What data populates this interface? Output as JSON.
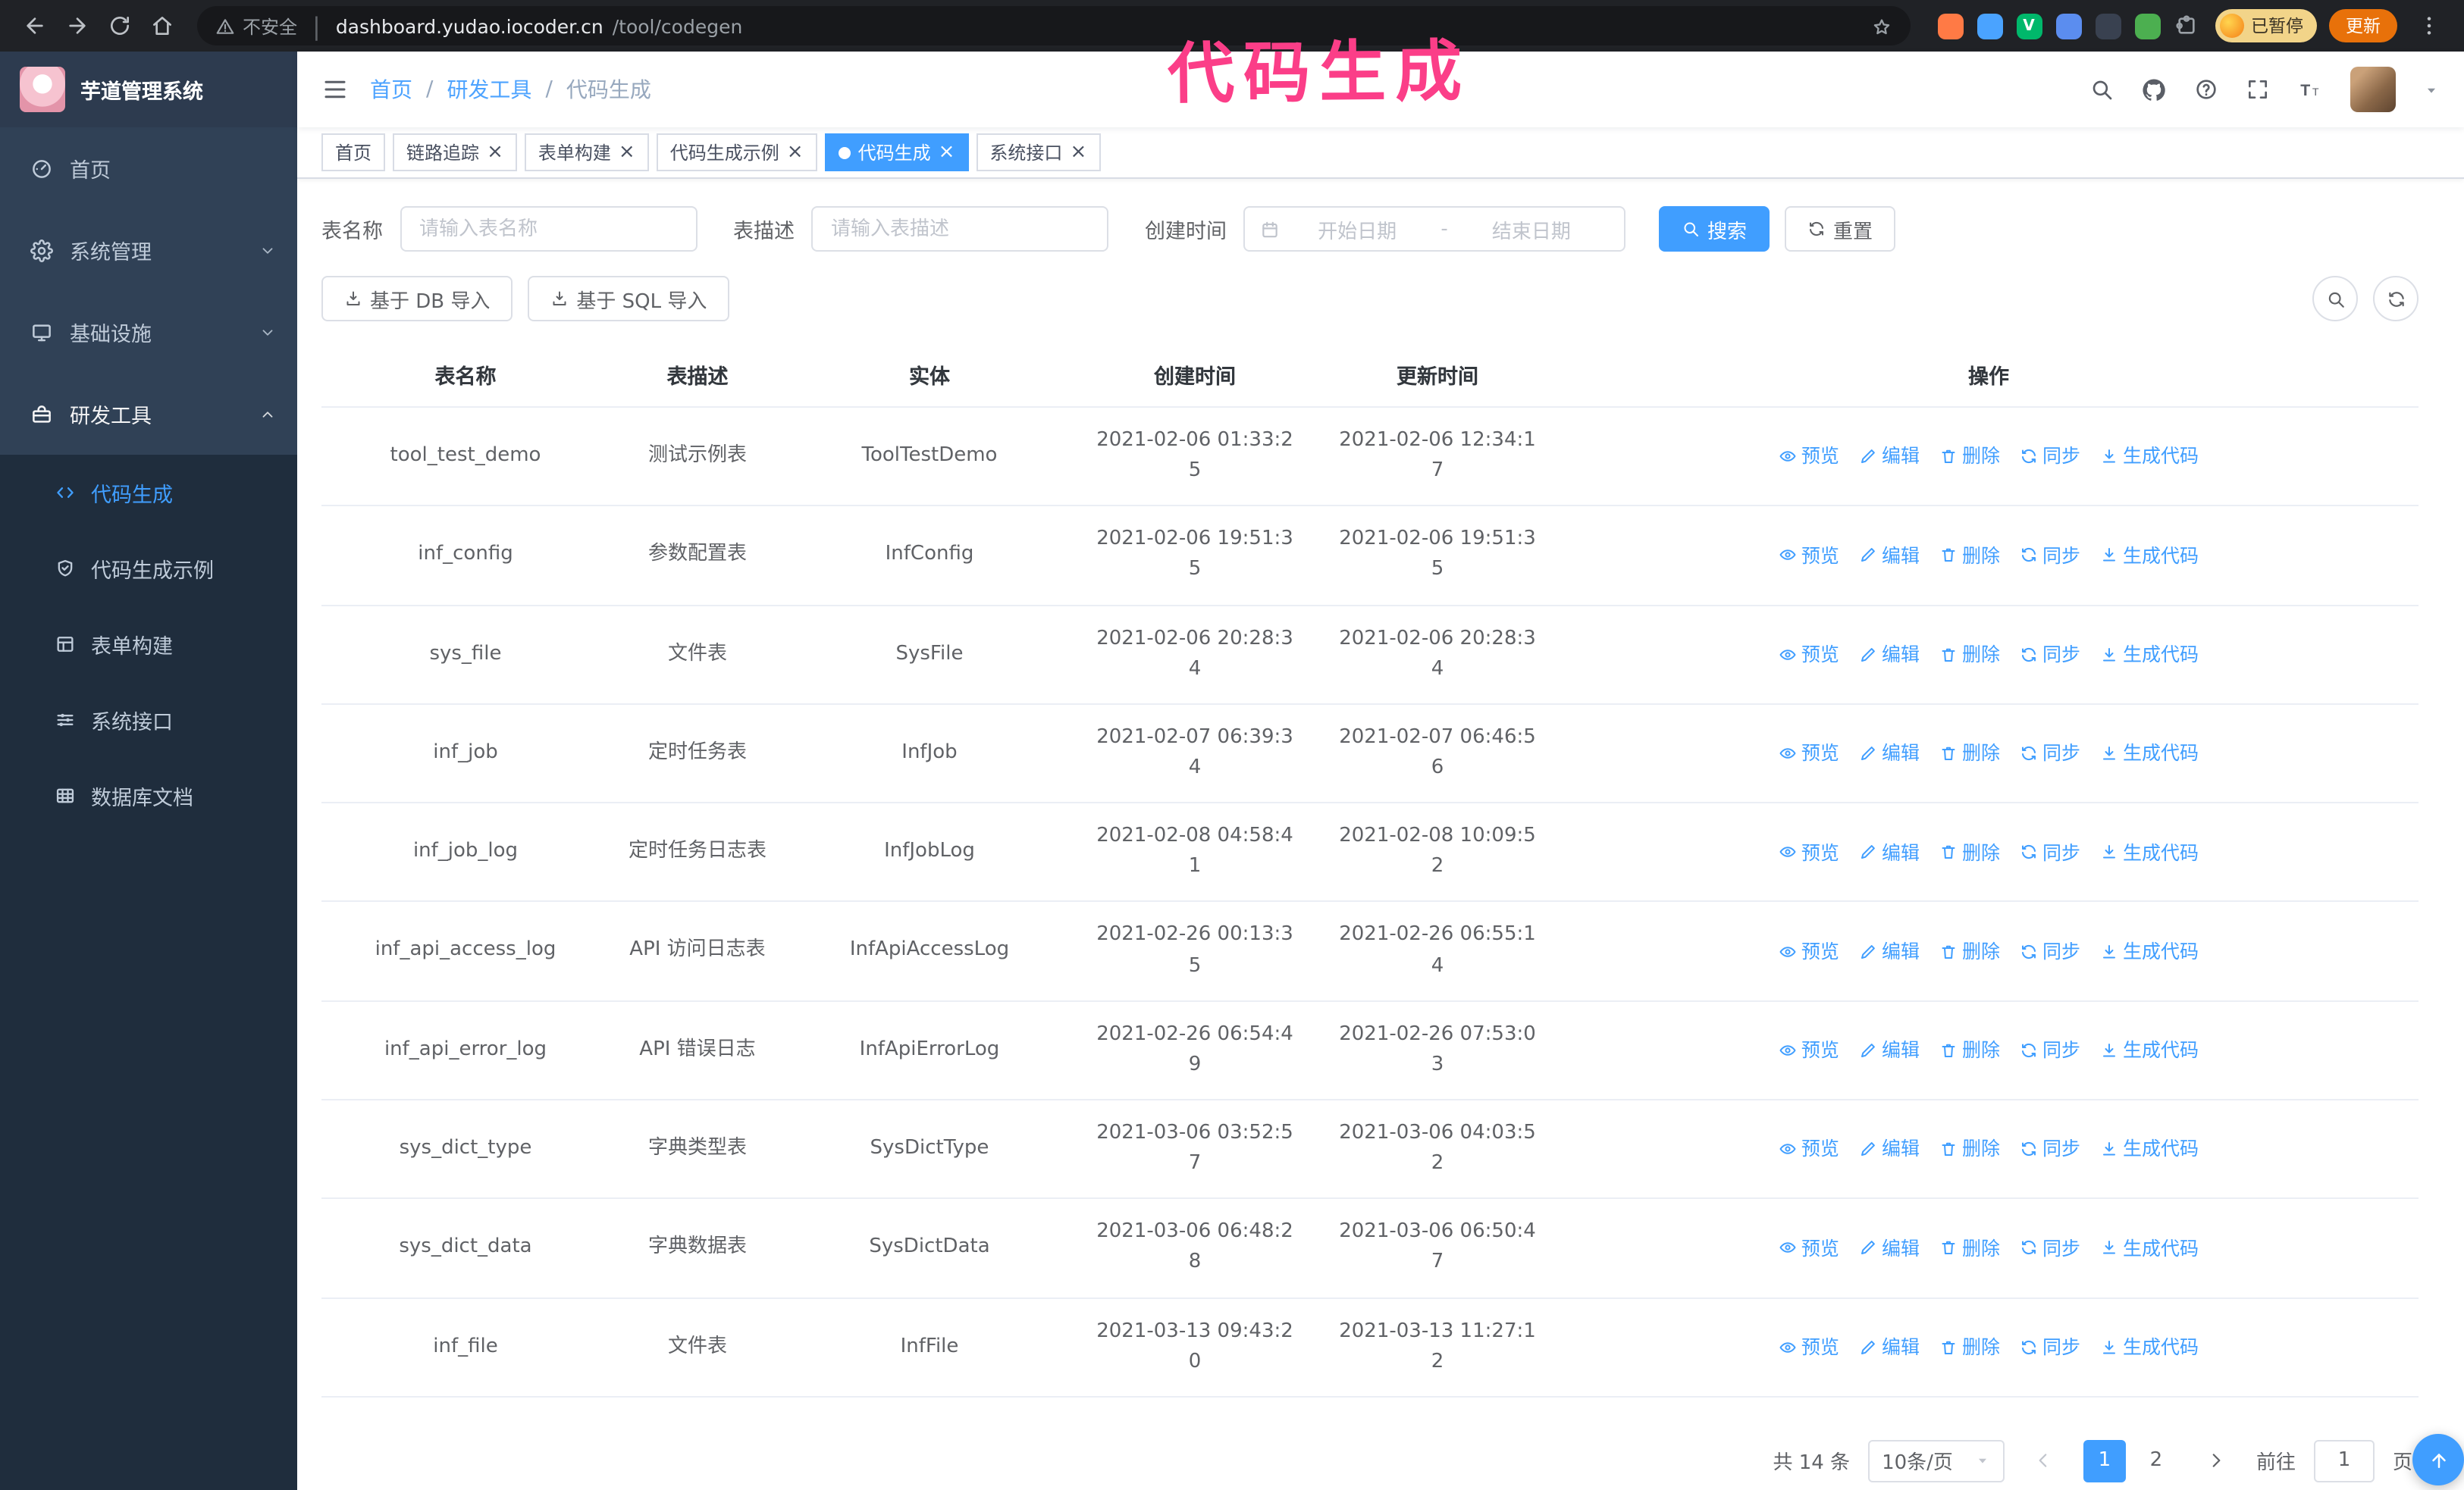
{
  "colors": {
    "accent": "#409eff",
    "sidebar_bg": "#304156",
    "submenu_bg": "#1f2d3d",
    "annotation_pink": "#fb3e88",
    "update_button": "#e8710a"
  },
  "annotation": {
    "text": "代码生成"
  },
  "browser": {
    "security_label": "不安全",
    "url_host": "dashboard.yudao.iocoder.cn",
    "url_path": "/tool/codegen",
    "paused_badge": "已暂停",
    "update_button": "更新",
    "extension_icons": [
      {
        "key": "fox",
        "color": "#ff7a45",
        "letter": ""
      },
      {
        "key": "water-drop",
        "color": "#4aa3ff",
        "letter": ""
      },
      {
        "key": "green-v",
        "color": "#00b86b",
        "letter": "V"
      },
      {
        "key": "users",
        "color": "#5b8def",
        "letter": ""
      },
      {
        "key": "dark-card",
        "color": "#394150",
        "letter": ""
      },
      {
        "key": "leaf",
        "color": "#4caf50",
        "letter": ""
      },
      {
        "key": "extensions-puzzle",
        "color": "transparent",
        "letter": "puzzle"
      }
    ]
  },
  "sidebar": {
    "logo_title": "芋道管理系统",
    "items": [
      {
        "key": "home",
        "label": "首页",
        "icon": "dashboard-icon"
      },
      {
        "key": "system-management",
        "label": "系统管理",
        "icon": "gear-icon",
        "expandable": true
      },
      {
        "key": "infrastructure",
        "label": "基础设施",
        "icon": "infra-icon",
        "expandable": true
      },
      {
        "key": "dev-tools",
        "label": "研发工具",
        "icon": "tools-icon",
        "expandable": true,
        "expanded": true,
        "children": [
          {
            "key": "codegen",
            "label": "代码生成",
            "icon": "code-icon",
            "active": true
          },
          {
            "key": "codegen-example",
            "label": "代码生成示例",
            "icon": "shield-icon"
          },
          {
            "key": "form-builder",
            "label": "表单构建",
            "icon": "form-icon"
          },
          {
            "key": "system-api",
            "label": "系统接口",
            "icon": "sliders-icon"
          },
          {
            "key": "db-doc",
            "label": "数据库文档",
            "icon": "dbdoc-icon"
          }
        ]
      }
    ]
  },
  "header": {
    "breadcrumb": [
      "首页",
      "研发工具",
      "代码生成"
    ]
  },
  "tabs": [
    {
      "key": "home",
      "label": "首页",
      "closable": false,
      "active": false
    },
    {
      "key": "tracing",
      "label": "链路追踪",
      "closable": true,
      "active": false
    },
    {
      "key": "form-builder",
      "label": "表单构建",
      "closable": true,
      "active": false
    },
    {
      "key": "codegen-example",
      "label": "代码生成示例",
      "closable": true,
      "active": false
    },
    {
      "key": "codegen",
      "label": "代码生成",
      "closable": true,
      "active": true
    },
    {
      "key": "system-api",
      "label": "系统接口",
      "closable": true,
      "active": false
    }
  ],
  "filters": {
    "table_name_label": "表名称",
    "table_name_placeholder": "请输入表名称",
    "table_desc_label": "表描述",
    "table_desc_placeholder": "请输入表描述",
    "create_time_label": "创建时间",
    "date_start_placeholder": "开始日期",
    "date_separator": "-",
    "date_end_placeholder": "结束日期",
    "search_button": "搜索",
    "reset_button": "重置"
  },
  "toolbar": {
    "import_db": "基于 DB 导入",
    "import_sql": "基于 SQL 导入"
  },
  "table": {
    "columns": [
      "表名称",
      "表描述",
      "实体",
      "创建时间",
      "更新时间",
      "操作"
    ],
    "column_keys": [
      "name",
      "desc",
      "entity",
      "create-time",
      "update-time",
      "operations"
    ],
    "operations": [
      {
        "key": "preview",
        "label": "预览",
        "icon": "eye-icon"
      },
      {
        "key": "edit",
        "label": "编辑",
        "icon": "edit-icon"
      },
      {
        "key": "delete",
        "label": "删除",
        "icon": "delete-icon"
      },
      {
        "key": "sync",
        "label": "同步",
        "icon": "sync-icon"
      },
      {
        "key": "generate",
        "label": "生成代码",
        "icon": "download-icon"
      }
    ],
    "rows": [
      {
        "name": "tool_test_demo",
        "desc": "测试示例表",
        "entity": "ToolTestDemo",
        "create_time": "2021-02-06 01:33:25",
        "update_time": "2021-02-06 12:34:17"
      },
      {
        "name": "inf_config",
        "desc": "参数配置表",
        "entity": "InfConfig",
        "create_time": "2021-02-06 19:51:35",
        "update_time": "2021-02-06 19:51:35"
      },
      {
        "name": "sys_file",
        "desc": "文件表",
        "entity": "SysFile",
        "create_time": "2021-02-06 20:28:34",
        "update_time": "2021-02-06 20:28:34"
      },
      {
        "name": "inf_job",
        "desc": "定时任务表",
        "entity": "InfJob",
        "create_time": "2021-02-07 06:39:34",
        "update_time": "2021-02-07 06:46:56"
      },
      {
        "name": "inf_job_log",
        "desc": "定时任务日志表",
        "entity": "InfJobLog",
        "create_time": "2021-02-08 04:58:41",
        "update_time": "2021-02-08 10:09:52"
      },
      {
        "name": "inf_api_access_log",
        "desc": "API 访问日志表",
        "entity": "InfApiAccessLog",
        "create_time": "2021-02-26 00:13:35",
        "update_time": "2021-02-26 06:55:14"
      },
      {
        "name": "inf_api_error_log",
        "desc": "API 错误日志",
        "entity": "InfApiErrorLog",
        "create_time": "2021-02-26 06:54:49",
        "update_time": "2021-02-26 07:53:03"
      },
      {
        "name": "sys_dict_type",
        "desc": "字典类型表",
        "entity": "SysDictType",
        "create_time": "2021-03-06 03:52:57",
        "update_time": "2021-03-06 04:03:52"
      },
      {
        "name": "sys_dict_data",
        "desc": "字典数据表",
        "entity": "SysDictData",
        "create_time": "2021-03-06 06:48:28",
        "update_time": "2021-03-06 06:50:47"
      },
      {
        "name": "inf_file",
        "desc": "文件表",
        "entity": "InfFile",
        "create_time": "2021-03-13 09:43:20",
        "update_time": "2021-03-13 11:27:12"
      }
    ]
  },
  "pagination": {
    "total_text": "共 14 条",
    "page_size": "10条/页",
    "pages": [
      "1",
      "2"
    ],
    "active_page": "1",
    "goto_label": "前往",
    "goto_value": "1",
    "goto_suffix": "页"
  }
}
